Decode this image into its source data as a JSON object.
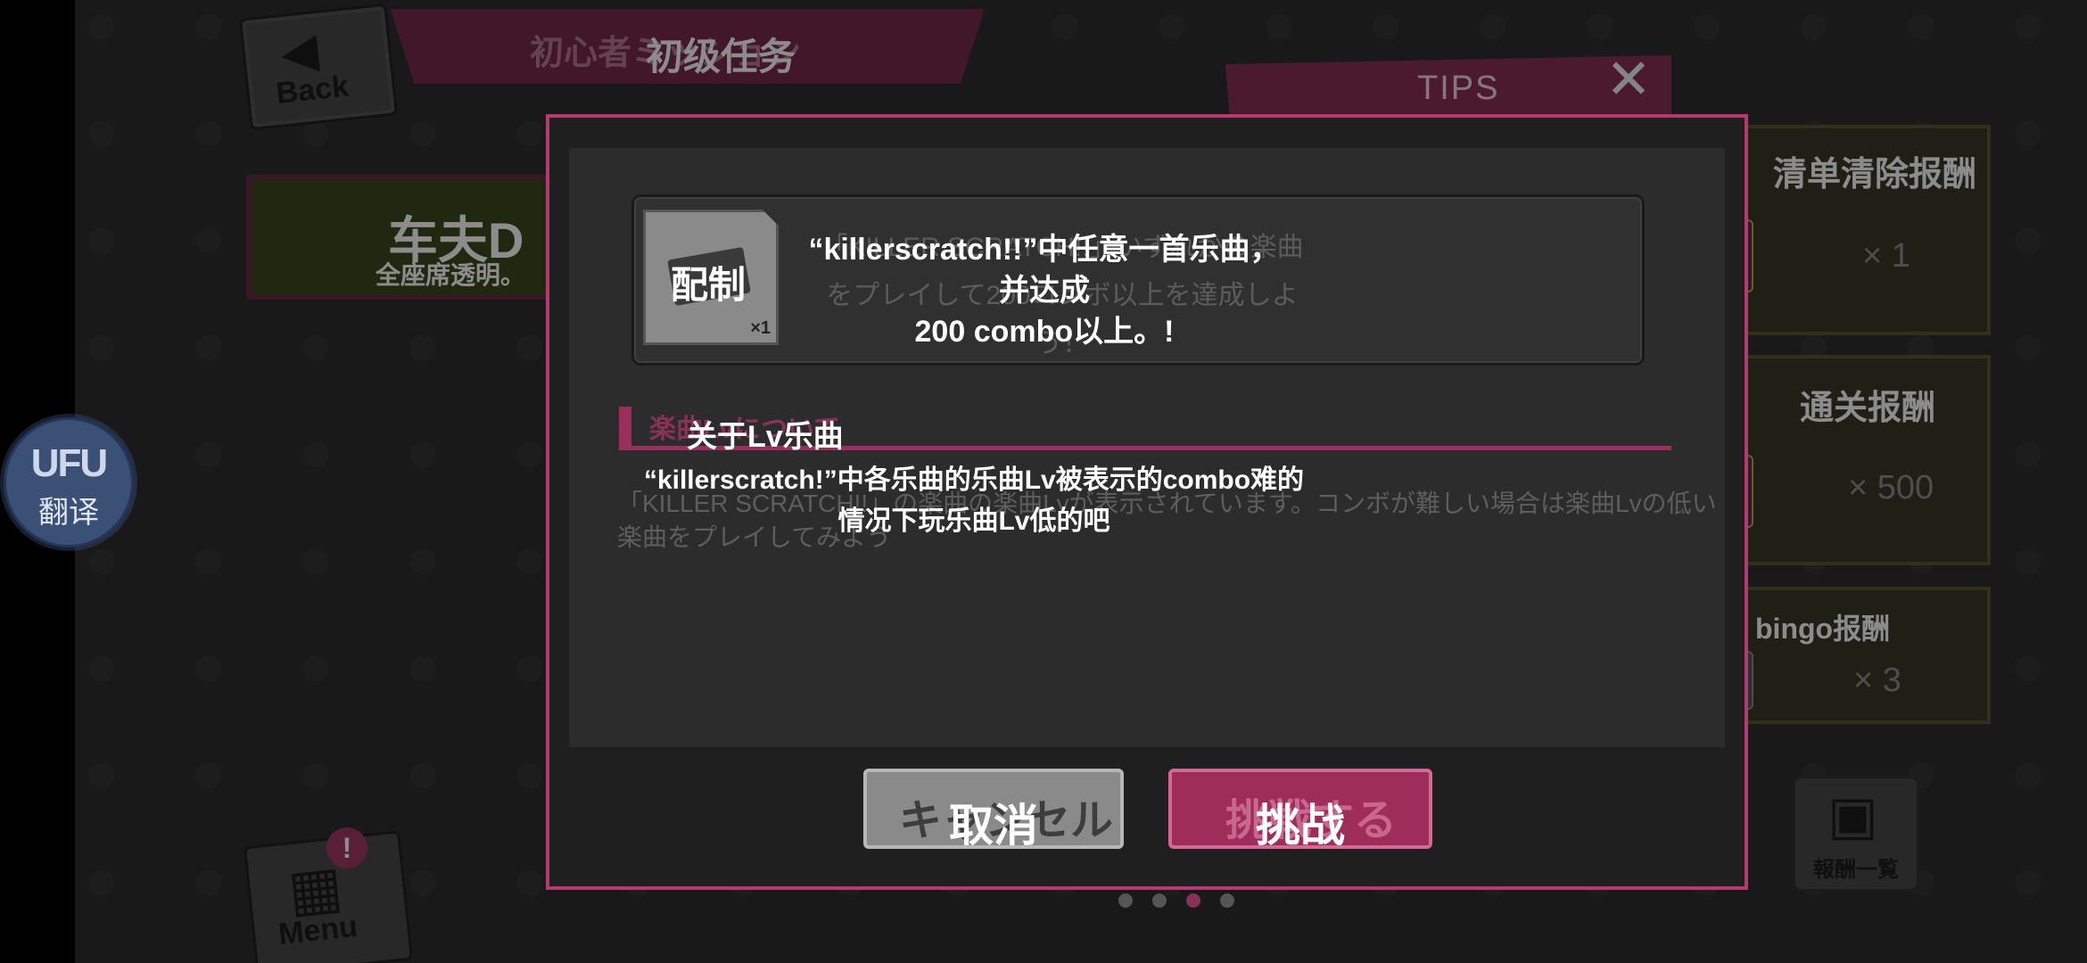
{
  "header": {
    "back_label": "Back",
    "title_jp": "初心者ミッション",
    "title": "初级任务",
    "tips_label": "TIPS"
  },
  "left_card": {
    "title": "车夫D",
    "subtitle": "全座席透明。"
  },
  "translate": {
    "logo": "UFU",
    "label": "翻译"
  },
  "menu": {
    "label": "Menu",
    "badge": "!"
  },
  "rewards": [
    {
      "title": "清单清除报酬",
      "qty": "× 1"
    },
    {
      "title": "通关报酬",
      "qty": "× 500"
    },
    {
      "title": "bingo报酬",
      "qty": "× 3"
    }
  ],
  "reward_list_label": "報酬一覧",
  "modal": {
    "item_name": "配制",
    "item_count": "×1",
    "mission_jp": "「KILLER SCRATCH!!」いずれかの楽曲をプレイして200コンボ以上を達成しよう！",
    "mission_line1": "“killerscratch!!”中任意一首乐曲，并达成",
    "mission_line2": "200 combo以上。!",
    "section_jp": "楽曲Lvについて",
    "section_title": "关于Lv乐曲",
    "section_jp_body": "「KILLER SCRATCH!!」の楽曲の楽曲Lvが表示されています。コンボが難しい場合は楽曲Lvの低い楽曲をプレイしてみよう",
    "section_line1": "“killerscratch!”中各乐曲的乐曲Lv被表示的combo难的",
    "section_line2": "情况下玩乐曲Lv低的吧",
    "cancel_jp": "キャンセル",
    "cancel_label": "取消",
    "go_jp": "挑戦する",
    "go_label": "挑战"
  },
  "pagination": {
    "count": 4,
    "active_index": 2
  },
  "colors": {
    "accent": "#9e2d5a",
    "modal_border": "#b43b6f",
    "background": "#2e2e2e"
  }
}
